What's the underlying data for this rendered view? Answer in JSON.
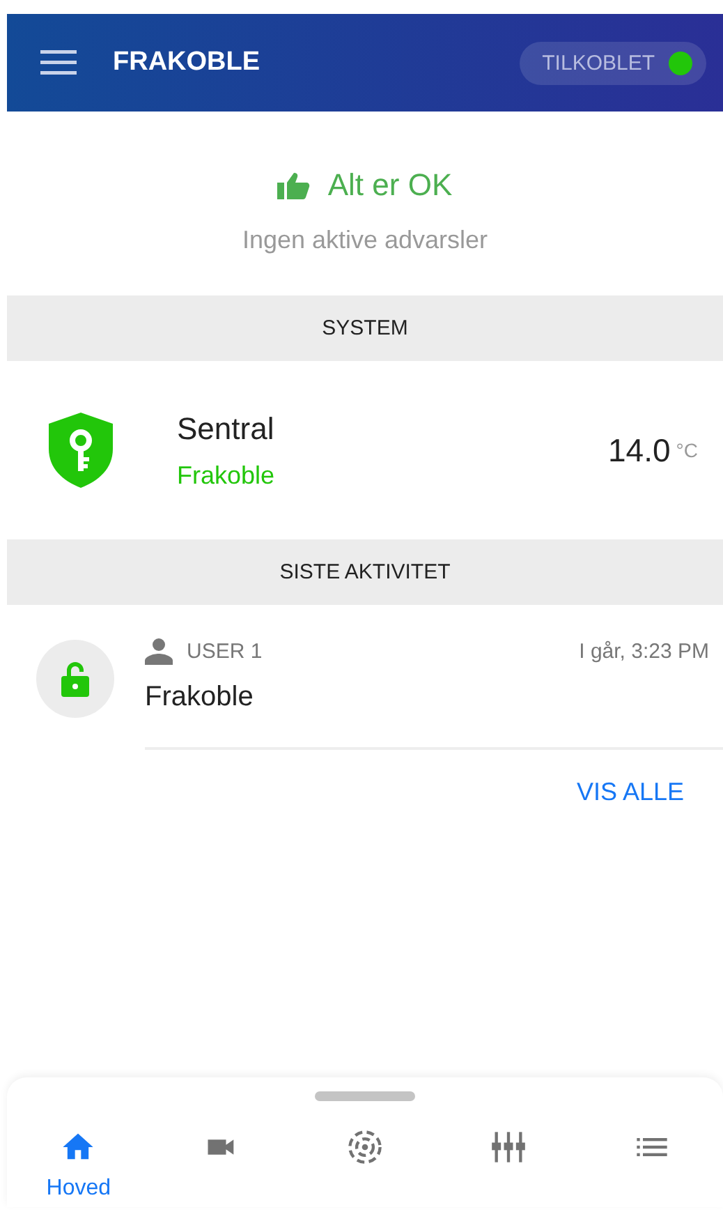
{
  "header": {
    "title": "FRAKOBLE",
    "status": {
      "label": "TILKOBLET",
      "color": "#22c60a"
    }
  },
  "summary": {
    "title": "Alt er OK",
    "subtitle": "Ingen aktive advarsler"
  },
  "system": {
    "heading": "SYSTEM",
    "device": {
      "name": "Sentral",
      "state": "Frakoble",
      "temperature": "14.0",
      "unit": "°C"
    }
  },
  "activity": {
    "heading": "SISTE AKTIVITET",
    "items": [
      {
        "user": "USER 1",
        "time": "I går, 3:23 PM",
        "action": "Frakoble"
      }
    ],
    "more": "VIS ALLE"
  },
  "nav": [
    {
      "kind": "home",
      "label": "Hoved",
      "selected": true
    },
    {
      "kind": "camera",
      "selected": false
    },
    {
      "kind": "sensor",
      "selected": false
    },
    {
      "kind": "controls",
      "selected": false
    },
    {
      "kind": "list",
      "selected": false
    }
  ]
}
